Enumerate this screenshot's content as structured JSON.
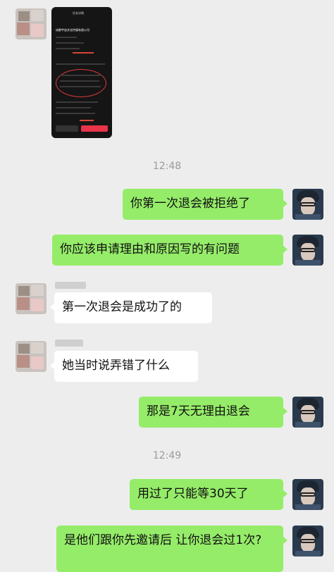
{
  "chat": {
    "time_1": "12:48",
    "time_2": "12:49",
    "messages": [
      {
        "side": "right",
        "text": "你第一次退会被拒绝了"
      },
      {
        "side": "right",
        "text": "你应该申请理由和原因写的有问题"
      },
      {
        "side": "left",
        "text": "第一次退会是成功了的"
      },
      {
        "side": "left",
        "text": "她当时说弄错了什么"
      },
      {
        "side": "right",
        "text": "那是7天无理由退会"
      },
      {
        "side": "right",
        "text": "用过了只能等30天了"
      },
      {
        "side": "right",
        "text": "是他们跟你先邀请后 让你退会过1次?"
      }
    ]
  },
  "screenshot_thumb": {
    "header": "任务详情",
    "company": "成都宇宙文化传媒有限公司"
  },
  "colors": {
    "background": "#ededed",
    "sent_bubble": "#95ec69",
    "received_bubble": "#ffffff",
    "timestamp": "#9a9a9a"
  }
}
